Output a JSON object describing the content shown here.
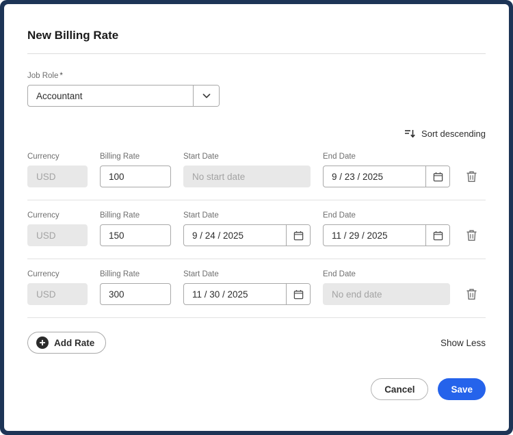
{
  "modal": {
    "title": "New Billing Rate",
    "job_role": {
      "label": "Job Role",
      "required_marker": "*",
      "value": "Accountant"
    },
    "sort": {
      "label": "Sort descending"
    },
    "columns": {
      "currency": "Currency",
      "billing_rate": "Billing Rate",
      "start_date": "Start Date",
      "end_date": "End Date"
    },
    "rows": [
      {
        "currency": {
          "value": "USD",
          "disabled": true
        },
        "billing_rate": {
          "value": "100"
        },
        "start_date": {
          "value": "",
          "placeholder": "No start date",
          "disabled": true
        },
        "end_date": {
          "value": "9 / 23 / 2025",
          "disabled": false
        }
      },
      {
        "currency": {
          "value": "USD",
          "disabled": true
        },
        "billing_rate": {
          "value": "150"
        },
        "start_date": {
          "value": "9 / 24 / 2025",
          "disabled": false
        },
        "end_date": {
          "value": "11 / 29 / 2025",
          "disabled": false
        }
      },
      {
        "currency": {
          "value": "USD",
          "disabled": true
        },
        "billing_rate": {
          "value": "300"
        },
        "start_date": {
          "value": "11 / 30 / 2025",
          "disabled": false
        },
        "end_date": {
          "value": "",
          "placeholder": "No end date",
          "disabled": true
        }
      }
    ],
    "add_rate_label": "Add Rate",
    "show_less_label": "Show Less",
    "footer": {
      "cancel_label": "Cancel",
      "save_label": "Save"
    },
    "colors": {
      "accent_blue": "#2563eb",
      "frame_navy": "#1d3456",
      "disabled_gray": "#e8e8e8"
    }
  }
}
